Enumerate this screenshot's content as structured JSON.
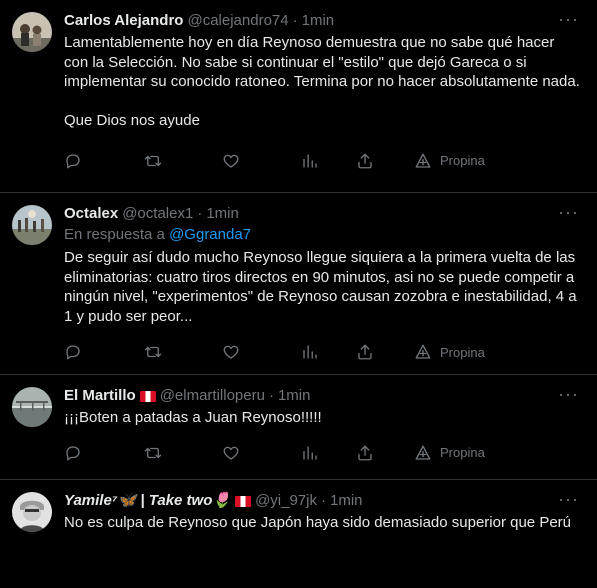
{
  "tweets": [
    {
      "name": "Carlos Alejandro",
      "handle": "@calejandro74",
      "separator": "·",
      "time": "1min",
      "paragraphs": [
        "Lamentablemente hoy en día Reynoso demuestra que no sabe qué hacer con la Selección. No sabe si continuar el \"estilo\" que dejó Gareca o si implementar su conocido ratoneo. Termina por no hacer absolutamente nada.",
        "Que Dios nos ayude"
      ],
      "promote_label": "Propina"
    },
    {
      "name": "Octalex",
      "handle": "@octalex1",
      "separator": "·",
      "time": "1min",
      "reply_prefix": "En respuesta a",
      "reply_handle": "@Ggranda7",
      "paragraphs": [
        "De seguir así dudo mucho Reynoso llegue siquiera a la primera vuelta de las eliminatorias: cuatro tiros directos en 90 minutos, asi no se puede competir a ningún nivel, \"experimentos\" de Reynoso causan zozobra e inestabilidad, 4 a 1 y pudo ser peor..."
      ],
      "promote_label": "Propina"
    },
    {
      "name": "El Martillo",
      "handle": "@elmartilloperu",
      "separator": "·",
      "time": "1min",
      "paragraphs": [
        "¡¡¡Boten a patadas a Juan Reynoso!!!!!"
      ],
      "promote_label": "Propina"
    },
    {
      "name": "Yamile⁷🦋 | Take two🌷",
      "handle": "@yi_97jk",
      "separator": "·",
      "time": "1min",
      "paragraphs": [
        "No es culpa de Reynoso que Japón haya sido demasiado superior que Perú"
      ]
    }
  ],
  "icons": {
    "reply": "reply-icon",
    "retweet": "retweet-icon",
    "like": "heart-icon",
    "views": "views-icon",
    "share": "share-icon",
    "promote": "promote-icon",
    "more": "more-icon"
  },
  "colors": {
    "background": "#000000",
    "text": "#e7e9ea",
    "muted": "#71767b",
    "link": "#1d9bf0",
    "divider": "#2f3336"
  }
}
